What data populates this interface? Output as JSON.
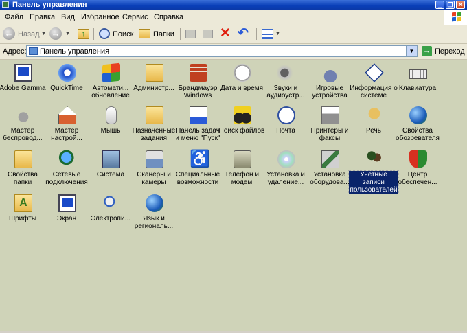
{
  "window": {
    "title": "Панель управления"
  },
  "menu": [
    "Файл",
    "Правка",
    "Вид",
    "Избранное",
    "Сервис",
    "Справка"
  ],
  "toolbar": {
    "back": "Назад",
    "search": "Поиск",
    "folders": "Папки"
  },
  "address": {
    "label": "Адрес:",
    "value": "Панель управления",
    "go": "Переход"
  },
  "items": [
    {
      "label": "Adobe Gamma",
      "icon": "monitor-icon"
    },
    {
      "label": "QuickTime",
      "icon": "quicktime-icon"
    },
    {
      "label": "Автомати... обновление",
      "icon": "windows-update-icon"
    },
    {
      "label": "Администр...",
      "icon": "admin-tools-icon"
    },
    {
      "label": "Брандмауэр Windows",
      "icon": "firewall-icon"
    },
    {
      "label": "Дата и время",
      "icon": "clock-icon"
    },
    {
      "label": "Звуки и аудиоустр...",
      "icon": "speaker-icon"
    },
    {
      "label": "Игровые устройства",
      "icon": "joystick-icon"
    },
    {
      "label": "Информация о системе",
      "icon": "info-icon"
    },
    {
      "label": "Клавиатура",
      "icon": "keyboard-icon"
    },
    {
      "label": "Мастер беспровод...",
      "icon": "wireless-wizard-icon"
    },
    {
      "label": "Мастер настрой...",
      "icon": "network-setup-icon"
    },
    {
      "label": "Мышь",
      "icon": "mouse-icon"
    },
    {
      "label": "Назначенные задания",
      "icon": "scheduled-tasks-icon"
    },
    {
      "label": "Панель задач и меню \"Пуск\"",
      "icon": "taskbar-icon"
    },
    {
      "label": "Поиск файлов",
      "icon": "search-files-icon"
    },
    {
      "label": "Почта",
      "icon": "mail-icon"
    },
    {
      "label": "Принтеры и факсы",
      "icon": "printer-icon"
    },
    {
      "label": "Речь",
      "icon": "speech-icon"
    },
    {
      "label": "Свойства обозревателя",
      "icon": "internet-options-icon"
    },
    {
      "label": "Свойства папки",
      "icon": "folder-options-icon"
    },
    {
      "label": "Сетевые подключения",
      "icon": "network-icon"
    },
    {
      "label": "Система",
      "icon": "system-icon"
    },
    {
      "label": "Сканеры и камеры",
      "icon": "scanner-icon"
    },
    {
      "label": "Специальные возможности",
      "icon": "accessibility-icon"
    },
    {
      "label": "Телефон и модем",
      "icon": "phone-icon"
    },
    {
      "label": "Установка и удаление...",
      "icon": "add-remove-icon"
    },
    {
      "label": "Установка оборудова...",
      "icon": "hardware-icon"
    },
    {
      "label": "Учетные записи пользователей",
      "icon": "user-accounts-icon"
    },
    {
      "label": "Центр обеспечен...",
      "icon": "security-center-icon"
    },
    {
      "label": "Шрифты",
      "icon": "fonts-icon"
    },
    {
      "label": "Экран",
      "icon": "display-icon"
    },
    {
      "label": "Электропи...",
      "icon": "power-icon"
    },
    {
      "label": "Язык и региональ...",
      "icon": "regional-icon"
    }
  ],
  "selected_item": "Учетные записи пользователей"
}
